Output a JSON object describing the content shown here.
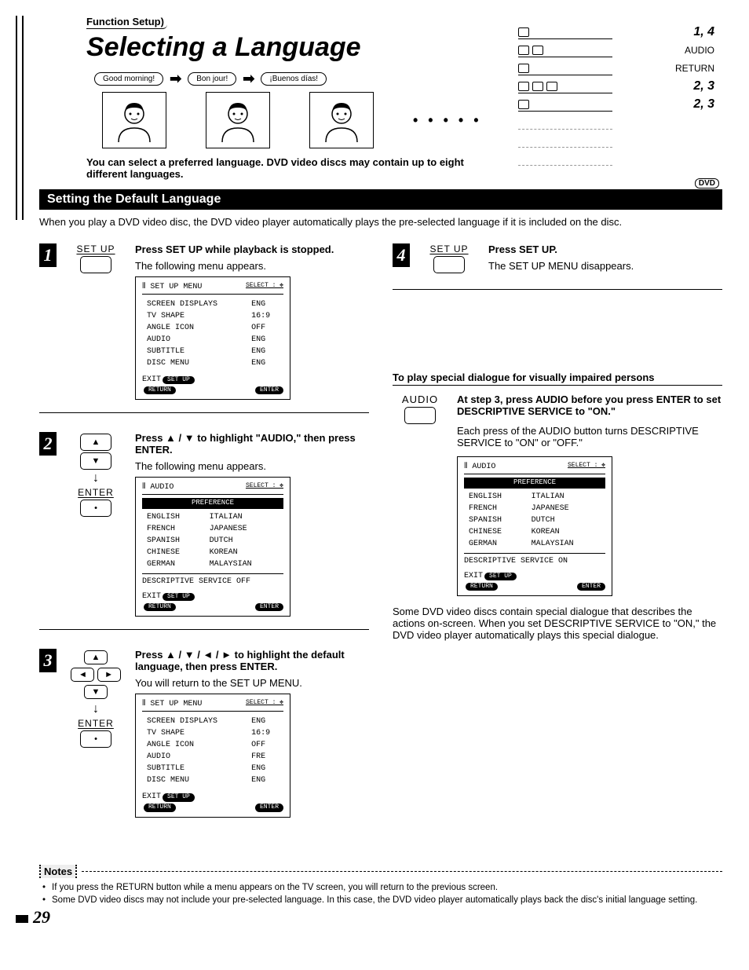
{
  "page_number": "29",
  "breadcrumb": "Function Setup",
  "title": "Selecting a Language",
  "bubbles": [
    "Good morning!",
    "Bon jour!",
    "¡Buenos días!"
  ],
  "intro": "You can select a preferred language. DVD video discs may contain up to eight different languages.",
  "remote": {
    "r1": "1, 4",
    "r2": "AUDIO",
    "r3": "RETURN",
    "r4": "2, 3",
    "r5": "2, 3"
  },
  "section_heading": "Setting the Default Language",
  "dvd_tag": "DVD",
  "lead": "When you play a DVD video disc, the DVD video player automatically plays the pre-selected language if it is included on the disc.",
  "steps": {
    "s1": {
      "control_label": "SET UP",
      "title": "Press SET UP while playback is stopped.",
      "text": "The following menu appears.",
      "menu": {
        "header": "SET UP MENU",
        "select": "SELECT : ✥",
        "rows": [
          [
            "SCREEN DISPLAYS",
            "ENG"
          ],
          [
            "TV SHAPE",
            "16:9"
          ],
          [
            "ANGLE ICON",
            "OFF"
          ],
          [
            "AUDIO",
            "ENG"
          ],
          [
            "SUBTITLE",
            "ENG"
          ],
          [
            "DISC MENU",
            "ENG"
          ]
        ],
        "exit": "EXIT",
        "exit_pill": "SET UP",
        "return_pill": "RETURN",
        "enter_pill": "ENTER"
      }
    },
    "s2": {
      "control_label": "ENTER",
      "title": "Press ▲ / ▼ to highlight \"AUDIO,\" then press ENTER.",
      "text": "The following menu appears.",
      "menu": {
        "header": "AUDIO",
        "select": "SELECT : ✥",
        "pref": "PREFERENCE",
        "rows": [
          [
            "ENGLISH",
            "ITALIAN"
          ],
          [
            "FRENCH",
            "JAPANESE"
          ],
          [
            "SPANISH",
            "DUTCH"
          ],
          [
            "CHINESE",
            "KOREAN"
          ],
          [
            "GERMAN",
            "MALAYSIAN"
          ]
        ],
        "desc": "DESCRIPTIVE SERVICE OFF",
        "exit": "EXIT",
        "exit_pill": "SET UP",
        "return_pill": "RETURN",
        "enter_pill": "ENTER"
      }
    },
    "s3": {
      "control_label": "ENTER",
      "title": "Press ▲ / ▼ / ◄ / ► to highlight the default language, then press ENTER.",
      "text": "You will return to the SET UP MENU.",
      "menu": {
        "header": "SET UP MENU",
        "select": "SELECT : ✥",
        "rows": [
          [
            "SCREEN DISPLAYS",
            "ENG"
          ],
          [
            "TV SHAPE",
            "16:9"
          ],
          [
            "ANGLE ICON",
            "OFF"
          ],
          [
            "AUDIO",
            "FRE"
          ],
          [
            "SUBTITLE",
            "ENG"
          ],
          [
            "DISC MENU",
            "ENG"
          ]
        ],
        "exit": "EXIT",
        "exit_pill": "SET UP",
        "return_pill": "RETURN",
        "enter_pill": "ENTER"
      }
    },
    "s4": {
      "control_label": "SET UP",
      "title": "Press SET UP.",
      "text": "The SET UP MENU disappears."
    }
  },
  "special": {
    "heading": "To play special dialogue for visually impaired persons",
    "control": "AUDIO",
    "p1": "At step 3, press AUDIO before you press ENTER to set DESCRIPTIVE SERVICE to \"ON.\"",
    "p2": "Each press of the AUDIO button turns DESCRIPTIVE SERVICE to \"ON\" or \"OFF.\"",
    "menu": {
      "header": "AUDIO",
      "select": "SELECT : ✥",
      "pref": "PREFERENCE",
      "rows": [
        [
          "ENGLISH",
          "ITALIAN"
        ],
        [
          "FRENCH",
          "JAPANESE"
        ],
        [
          "SPANISH",
          "DUTCH"
        ],
        [
          "CHINESE",
          "KOREAN"
        ],
        [
          "GERMAN",
          "MALAYSIAN"
        ]
      ],
      "desc": "DESCRIPTIVE SERVICE  ON",
      "exit": "EXIT",
      "exit_pill": "SET UP",
      "return_pill": "RETURN",
      "enter_pill": "ENTER"
    },
    "p3": "Some DVD video discs contain special dialogue that describes the actions on-screen. When you set DESCRIPTIVE SERVICE to \"ON,\" the DVD video player automatically plays this special dialogue."
  },
  "notes": {
    "label": "Notes",
    "items": [
      "If you press the RETURN button while a menu appears on the TV screen, you will return to the previous screen.",
      "Some DVD video discs may not include your pre-selected language. In this case, the DVD video player automatically plays back the disc's initial language setting."
    ]
  }
}
